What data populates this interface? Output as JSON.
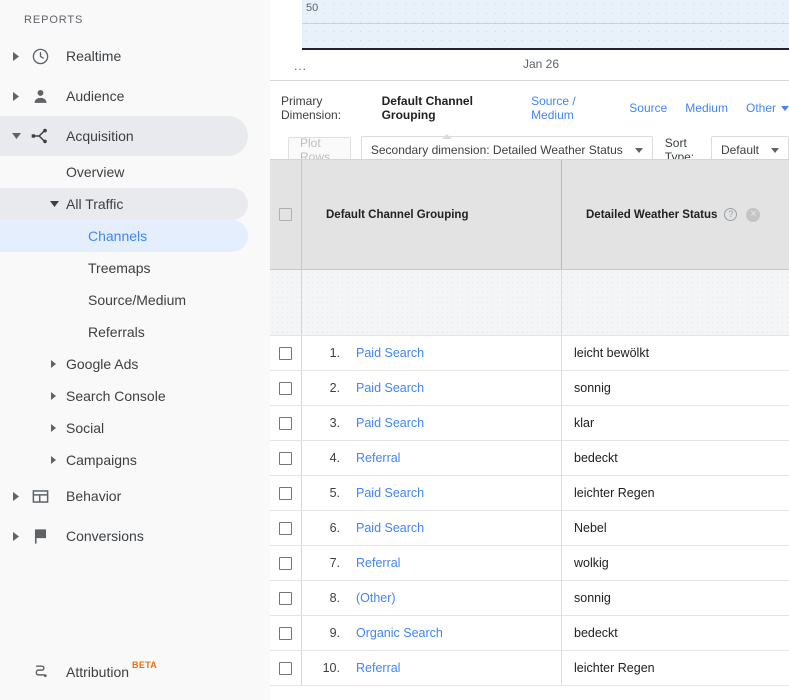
{
  "sidebar": {
    "section_label": "REPORTS",
    "items": [
      {
        "label": "Realtime",
        "icon": "clock-icon",
        "arrow": "right",
        "level": 1
      },
      {
        "label": "Audience",
        "icon": "person-icon",
        "arrow": "right",
        "level": 1
      },
      {
        "label": "Acquisition",
        "icon": "acquisition-icon",
        "arrow": "down",
        "level": 1,
        "state": "expanded"
      }
    ],
    "acquisition_children": [
      {
        "label": "Overview",
        "level": 2,
        "arrow": "none"
      },
      {
        "label": "All Traffic",
        "level": 2,
        "arrow": "down",
        "state": "expanded"
      }
    ],
    "all_traffic_children": [
      {
        "label": "Channels",
        "level": 3,
        "state": "selected"
      },
      {
        "label": "Treemaps",
        "level": 3
      },
      {
        "label": "Source/Medium",
        "level": 3
      },
      {
        "label": "Referrals",
        "level": 3
      }
    ],
    "acquisition_more": [
      {
        "label": "Google Ads",
        "level": 2,
        "arrow": "right"
      },
      {
        "label": "Search Console",
        "level": 2,
        "arrow": "right"
      },
      {
        "label": "Social",
        "level": 2,
        "arrow": "right"
      },
      {
        "label": "Campaigns",
        "level": 2,
        "arrow": "right"
      }
    ],
    "bottom_items": [
      {
        "label": "Behavior",
        "icon": "behavior-icon",
        "arrow": "right",
        "level": 1
      },
      {
        "label": "Conversions",
        "icon": "flag-icon",
        "arrow": "right",
        "level": 1
      }
    ],
    "attribution": {
      "label": "Attribution",
      "badge": "BETA",
      "icon": "attribution-icon"
    }
  },
  "chart": {
    "y_tick": "50",
    "x_ellipsis": "...",
    "x_tick": "Jan 26"
  },
  "primary_dimension": {
    "label": "Primary Dimension:",
    "active": "Default Channel Grouping",
    "links": [
      "Source / Medium",
      "Source",
      "Medium"
    ],
    "other": "Other"
  },
  "toolbar": {
    "plot_rows": "Plot Rows",
    "secondary_dimension": "Secondary dimension: Detailed Weather Status",
    "sort_type_label": "Sort Type:",
    "sort_type_value": "Default"
  },
  "table": {
    "columns": [
      "Default Channel Grouping",
      "Detailed Weather Status"
    ],
    "rows": [
      {
        "rank": "1.",
        "channel": "Paid Search",
        "weather": "leicht bewölkt"
      },
      {
        "rank": "2.",
        "channel": "Paid Search",
        "weather": "sonnig"
      },
      {
        "rank": "3.",
        "channel": "Paid Search",
        "weather": "klar"
      },
      {
        "rank": "4.",
        "channel": "Referral",
        "weather": "bedeckt"
      },
      {
        "rank": "5.",
        "channel": "Paid Search",
        "weather": "leichter Regen"
      },
      {
        "rank": "6.",
        "channel": "Paid Search",
        "weather": "Nebel"
      },
      {
        "rank": "7.",
        "channel": "Referral",
        "weather": "wolkig"
      },
      {
        "rank": "8.",
        "channel": "(Other)",
        "weather": "sonnig"
      },
      {
        "rank": "9.",
        "channel": "Organic Search",
        "weather": "bedeckt"
      },
      {
        "rank": "10.",
        "channel": "Referral",
        "weather": "leichter Regen"
      }
    ],
    "help_icon": "?",
    "remove_icon": "×"
  },
  "colors": {
    "link_blue": "#4285f4",
    "selected_bg": "#e4eefd",
    "expanded_bg": "#e8eaed",
    "chart_fill": "#e8f0fa",
    "beta_orange": "#e8710a"
  }
}
